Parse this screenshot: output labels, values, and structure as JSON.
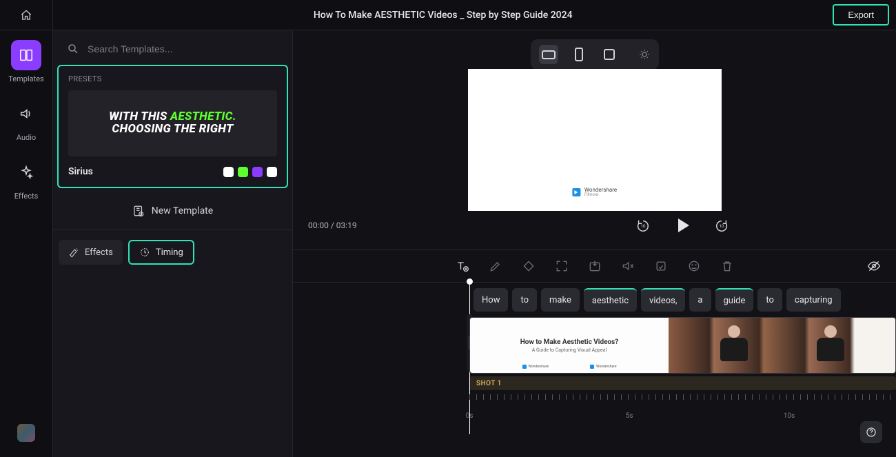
{
  "title": "How To Make AESTHETIC Videos _ Step by Step Guide 2024",
  "export_label": "Export",
  "rail": {
    "templates": "Templates",
    "audio": "Audio",
    "effects": "Effects"
  },
  "search": {
    "placeholder": "Search Templates..."
  },
  "presets": {
    "header": "PRESETS",
    "line1_a": "WITH THIS ",
    "line1_b": "AESTHETIC.",
    "line2": "CHOOSING THE RIGHT",
    "name": "Sirius",
    "swatches": [
      "#ffffff",
      "#5fff2e",
      "#8b3dff",
      "#ffffff"
    ]
  },
  "new_template_label": "New Template",
  "tabs": {
    "effects": "Effects",
    "timing": "Timing"
  },
  "player": {
    "timecode": "00:00 / 03:19"
  },
  "clip1": {
    "title": "How to Make Aesthetic Videos?",
    "subtitle": "A Guide to Capturing Visual Appeal"
  },
  "watermark": {
    "brand": "Wondershare",
    "product": "Filmora"
  },
  "shot_label": "SHOT 1",
  "words": [
    "How",
    "to",
    "make",
    "aesthetic",
    "videos,",
    "a",
    "guide",
    "to",
    "capturing"
  ],
  "word_highlights": [
    false,
    false,
    false,
    true,
    true,
    false,
    true,
    false,
    false
  ],
  "time_ticks": [
    {
      "label": "0s",
      "pos": 0
    },
    {
      "label": "5s",
      "pos": 232
    },
    {
      "label": "10s",
      "pos": 464
    }
  ]
}
